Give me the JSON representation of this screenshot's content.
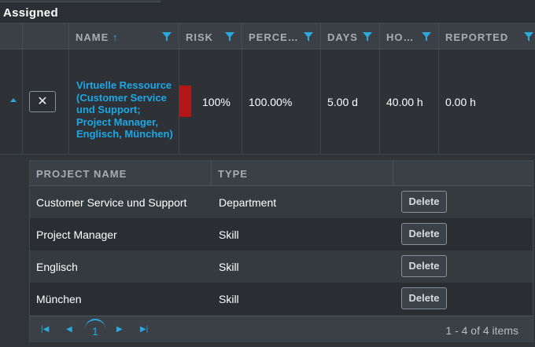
{
  "section_title": "Assigned",
  "columns": {
    "name": "NAME",
    "sort_arrow": "↑",
    "risk": "RISK",
    "percent": "PERCE…",
    "days": "DAYS",
    "hours": "HO…",
    "reported": "REPORTED"
  },
  "row": {
    "name": "Virtuelle Ressource (Customer Service und Support; Project Manager, Englisch, München)",
    "risk": "100%",
    "risk_color": "#b21616",
    "percent": "100.00%",
    "days": "5.00 d",
    "hours": "40.00 h",
    "reported": "0.00 h",
    "remove_label": "✕"
  },
  "detail": {
    "columns": {
      "project_name": "PROJECT NAME",
      "type": "TYPE"
    },
    "rows": [
      {
        "project_name": "Customer Service und Support",
        "type": "Department",
        "action": "Delete"
      },
      {
        "project_name": "Project Manager",
        "type": "Skill",
        "action": "Delete"
      },
      {
        "project_name": "Englisch",
        "type": "Skill",
        "action": "Delete"
      },
      {
        "project_name": "München",
        "type": "Skill",
        "action": "Delete"
      }
    ],
    "pager": {
      "current_page": "1",
      "info": "1 - 4 of 4 items"
    }
  },
  "accent_color": "#1ea7e4"
}
